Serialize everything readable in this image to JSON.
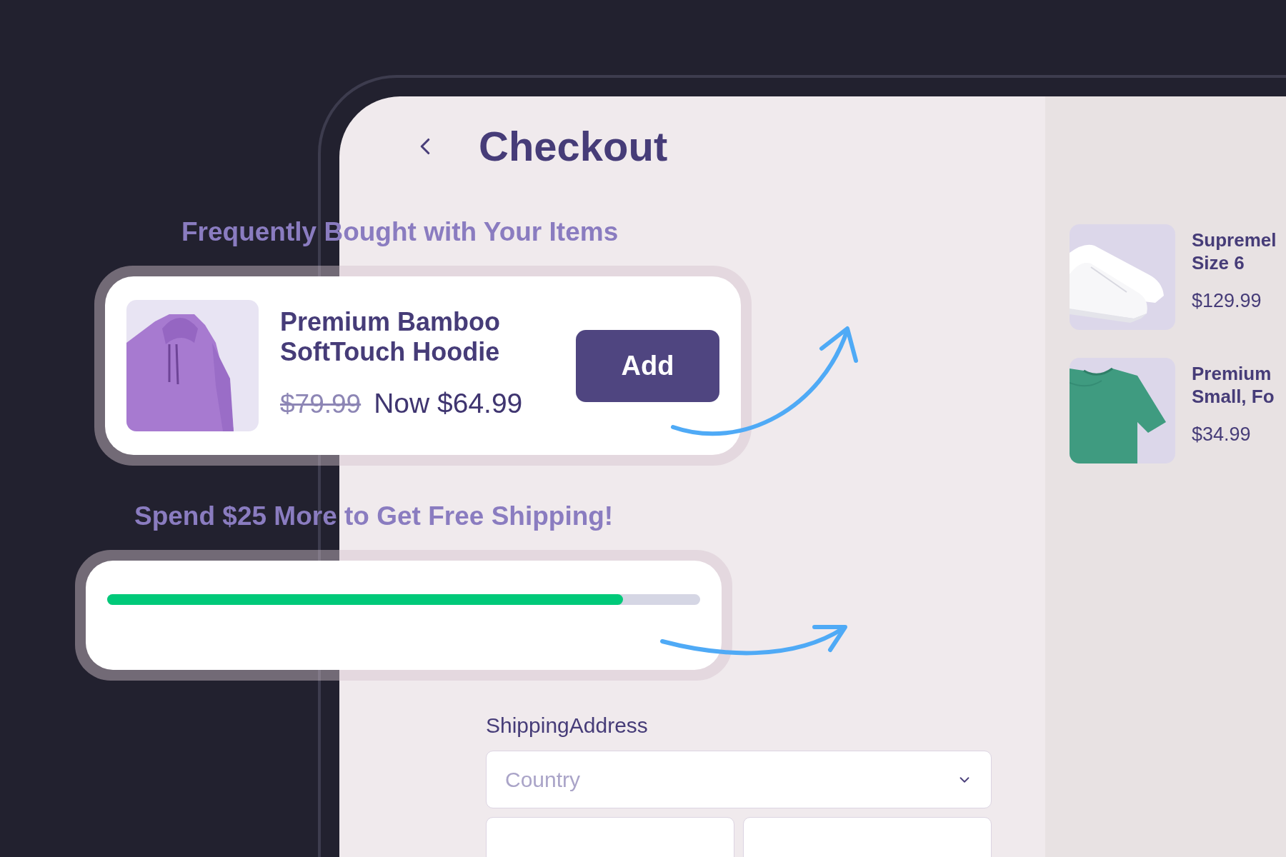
{
  "header": {
    "title": "Checkout"
  },
  "recommendation": {
    "heading": "Frequently Bought with Your Items",
    "product": {
      "name": "Premium Bamboo SoftTouch Hoodie",
      "old_price": "$79.99",
      "price": "Now $64.99"
    },
    "button": "Add"
  },
  "shipping_promo": {
    "heading": "Spend $25 More to Get Free Shipping!",
    "level": 0.87
  },
  "shipping_address": {
    "label": "ShippingAddress",
    "country": {
      "placeholder": "Country"
    }
  },
  "cart_items": [
    {
      "kind": "sneaker",
      "name": [
        "Supremel",
        "Size 6"
      ],
      "price": "$129.99"
    },
    {
      "kind": "tshirt",
      "name": [
        "Premium",
        "Small, Fo"
      ],
      "price": "$34.99"
    }
  ]
}
